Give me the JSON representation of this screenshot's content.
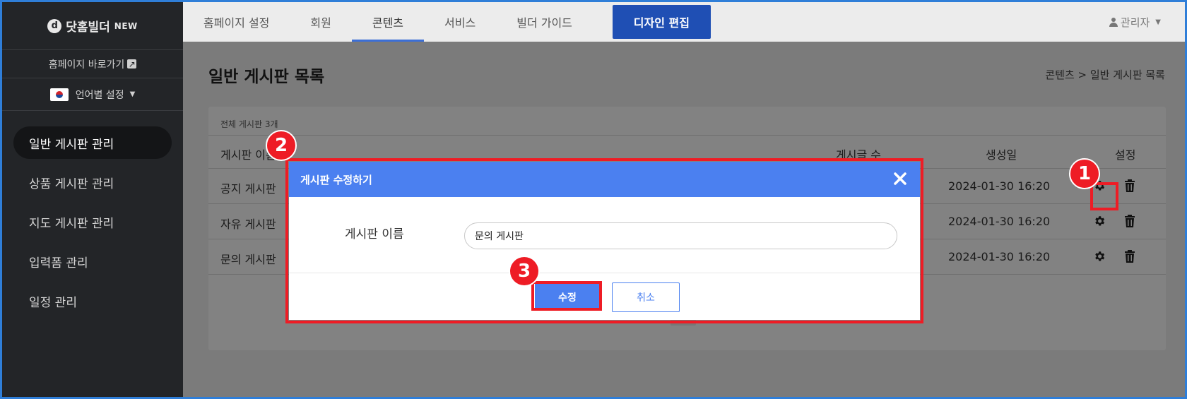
{
  "sidebar": {
    "logo_mark": "d",
    "logo_text": "닷홈빌더",
    "logo_badge": "NEW",
    "homepage_link": "홈페이지 바로가기",
    "lang_setting": "언어별 설정",
    "nav": [
      {
        "label": "일반 게시판 관리",
        "active": true
      },
      {
        "label": "상품 게시판 관리"
      },
      {
        "label": "지도 게시판 관리"
      },
      {
        "label": "입력폼 관리"
      },
      {
        "label": "일정 관리"
      }
    ]
  },
  "topbar": {
    "tabs": [
      "홈페이지 설정",
      "회원",
      "콘텐츠",
      "서비스",
      "빌더 가이드"
    ],
    "active_tab": "콘텐츠",
    "design_button": "디자인 편집",
    "admin_label": "관리자"
  },
  "main": {
    "title": "일반 게시판 목록",
    "breadcrumb": "콘텐츠 > 일반 게시판 목록",
    "count_label": "전체 게시판 3개",
    "columns": {
      "name": "게시판 이름",
      "posts": "게시글 수",
      "created": "생성일",
      "settings": "설정"
    },
    "rows": [
      {
        "name": "공지 게시판",
        "created": "2024-01-30 16:20"
      },
      {
        "name": "자유 게시판",
        "created": "2024-01-30 16:20"
      },
      {
        "name": "문의 게시판",
        "created": "2024-01-30 16:20"
      }
    ]
  },
  "modal": {
    "title": "게시판 수정하기",
    "field_label": "게시판 이름",
    "field_value": "문의 게시판",
    "submit": "수정",
    "cancel": "취소"
  },
  "annotations": {
    "step1": "1",
    "step2": "2",
    "step3": "3"
  },
  "colors": {
    "accent": "#4b80f0",
    "highlight": "#ee1c25",
    "design_button": "#1f4fb4"
  }
}
